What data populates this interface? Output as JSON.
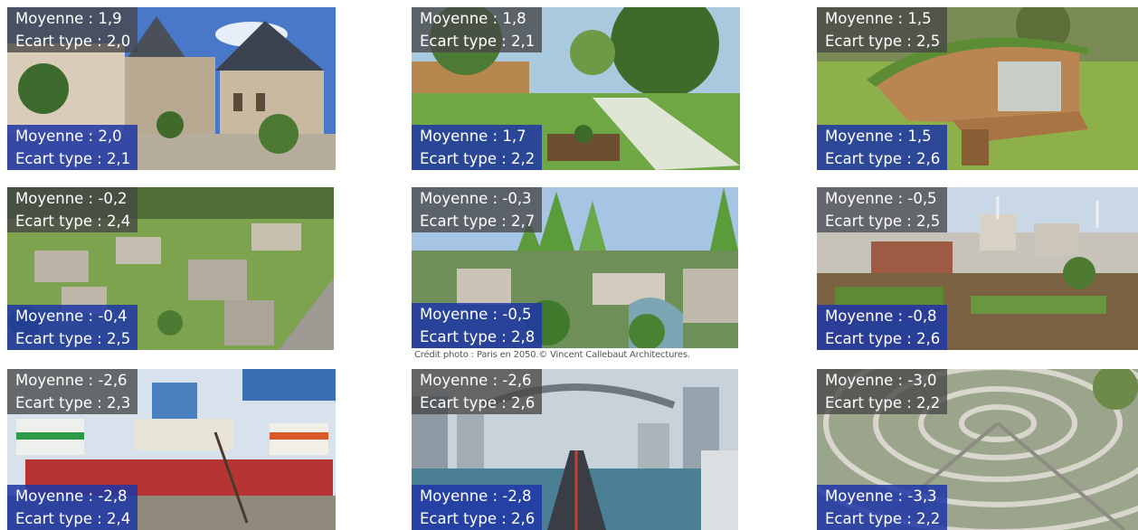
{
  "tiles": [
    {
      "top": {
        "mean": "Moyenne : 1,9",
        "sd": "Ecart type : 2,0"
      },
      "bottom": {
        "mean": "Moyenne : 2,0",
        "sd": "Ecart type : 2,1"
      },
      "scene": "medieval-town-square"
    },
    {
      "top": {
        "mean": "Moyenne : 1,8",
        "sd": "Ecart type : 2,1"
      },
      "bottom": {
        "mean": "Moyenne : 1,7",
        "sd": "Ecart type : 2,2"
      },
      "scene": "green-park-street"
    },
    {
      "top": {
        "mean": "Moyenne : 1,5",
        "sd": "Ecart type : 2,5"
      },
      "bottom": {
        "mean": "Moyenne : 1,5",
        "sd": "Ecart type : 2,6"
      },
      "scene": "eco-pod-house"
    },
    {
      "top": {
        "mean": "Moyenne : -0,2",
        "sd": "Ecart type : 2,4"
      },
      "bottom": {
        "mean": "Moyenne : -0,4",
        "sd": "Ecart type : 2,5"
      },
      "scene": "green-housing-estate"
    },
    {
      "top": {
        "mean": "Moyenne : -0,3",
        "sd": "Ecart type : 2,7"
      },
      "bottom": {
        "mean": "Moyenne : -0,5",
        "sd": "Ecart type : 2,8"
      },
      "scene": "vertical-forest-city"
    },
    {
      "top": {
        "mean": "Moyenne : -0,5",
        "sd": "Ecart type : 2,5"
      },
      "bottom": {
        "mean": "Moyenne : -0,8",
        "sd": "Ecart type : 2,6"
      },
      "scene": "urban-farm-wind-turbines"
    },
    {
      "top": {
        "mean": "Moyenne : -2,6",
        "sd": "Ecart type : 2,3"
      },
      "bottom": {
        "mean": "Moyenne : -2,8",
        "sd": "Ecart type : 2,4"
      },
      "scene": "stacked-caravans"
    },
    {
      "top": {
        "mean": "Moyenne : -2,6",
        "sd": "Ecart type : 2,6"
      },
      "bottom": {
        "mean": "Moyenne : -2,8",
        "sd": "Ecart type : 2,6"
      },
      "scene": "futuristic-megacity"
    },
    {
      "top": {
        "mean": "Moyenne : -3,0",
        "sd": "Ecart type : 2,2"
      },
      "bottom": {
        "mean": "Moyenne : -3,3",
        "sd": "Ecart type : 2,2"
      },
      "scene": "circular-suburb-aerial"
    }
  ],
  "credit": "Crédit photo : Paris en 2050.© Vincent Callebaut Architectures.",
  "colors": {
    "top_overlay": "#464646",
    "bottom_overlay": "#1e37a5"
  }
}
